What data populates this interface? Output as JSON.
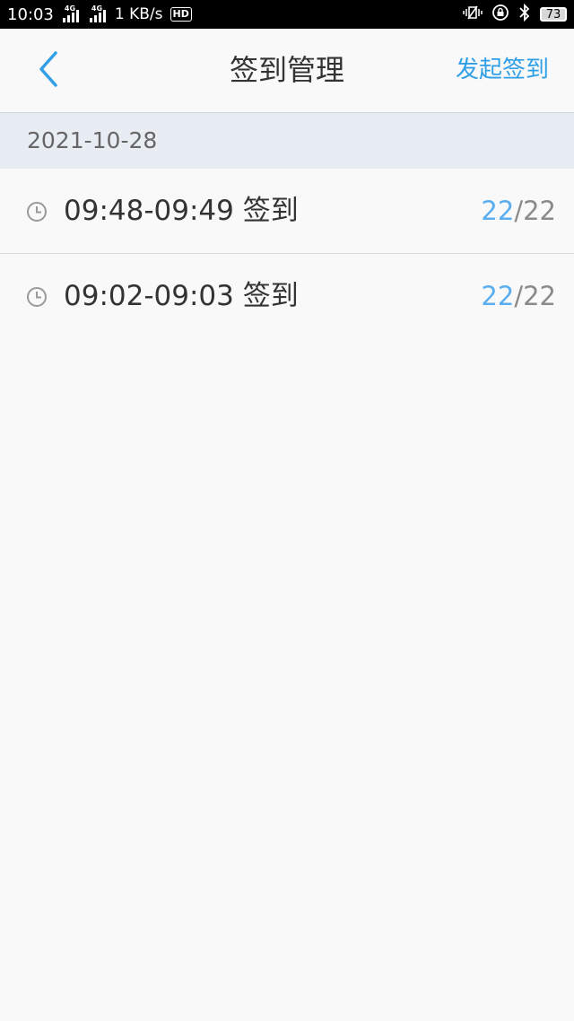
{
  "status_bar": {
    "time": "10:03",
    "signal_1_label": "4G",
    "signal_2_label": "4G",
    "speed": "1 KB/s",
    "hd_label": "HD",
    "battery": "73",
    "icons": [
      "signal-icon",
      "signal-icon",
      "hd-icon",
      "vibrate-icon",
      "lock-rotation-icon",
      "bluetooth-icon",
      "battery-icon"
    ]
  },
  "nav": {
    "back_icon": "chevron-left-icon",
    "title": "签到管理",
    "action": "发起签到"
  },
  "date_header": "2021-10-28",
  "items": [
    {
      "label": "09:48-09:49 签到",
      "done": "22",
      "separator": "/",
      "total": "22"
    },
    {
      "label": "09:02-09:03 签到",
      "done": "22",
      "separator": "/",
      "total": "22"
    }
  ],
  "colors": {
    "accent": "#2f9fe8",
    "count_done": "#5aaef0",
    "date_header_bg": "#e8ecf3"
  }
}
